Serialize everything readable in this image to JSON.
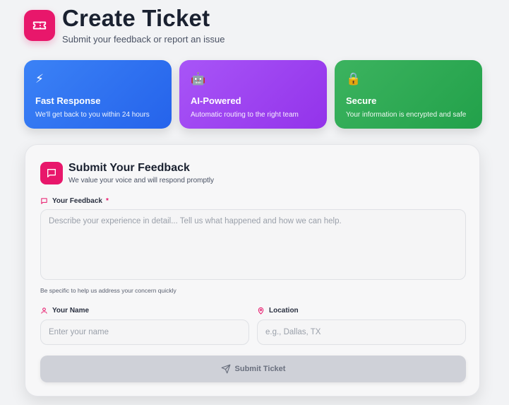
{
  "header": {
    "title": "Create Ticket",
    "subtitle": "Submit your feedback or report an issue",
    "logo_icon": "ticket-icon"
  },
  "features": [
    {
      "icon": "⚡",
      "icon_name": "lightning-icon",
      "title": "Fast Response",
      "desc": "We'll get back to you within 24 hours",
      "color": "#2563eb"
    },
    {
      "icon": "🤖",
      "icon_name": "robot-icon",
      "title": "AI-Powered",
      "desc": "Automatic routing to the right team",
      "color": "#9333ea"
    },
    {
      "icon": "🔒",
      "icon_name": "lock-icon",
      "title": "Secure",
      "desc": "Your information is encrypted and safe",
      "color": "#22a14a"
    }
  ],
  "form": {
    "title": "Submit Your Feedback",
    "subtitle": "We value your voice and will respond promptly",
    "feedback": {
      "label": "Your Feedback",
      "required_mark": "*",
      "placeholder": "Describe your experience in detail... Tell us what happened and how we can help.",
      "value": "",
      "hint": "Be specific to help us address your concern quickly"
    },
    "name": {
      "label": "Your Name",
      "placeholder": "Enter your name",
      "value": ""
    },
    "location": {
      "label": "Location",
      "placeholder": "e.g., Dallas, TX",
      "value": ""
    },
    "submit_label": "Submit Ticket"
  },
  "colors": {
    "accent": "#e8176b",
    "submit_disabled": "#cfd1d8"
  }
}
